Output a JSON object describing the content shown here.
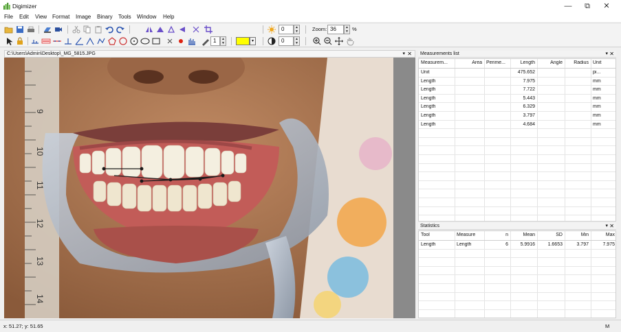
{
  "window": {
    "title": "Digimizer",
    "controls": {
      "minimize": "—",
      "maximize": "⧉",
      "close": "✕"
    }
  },
  "menu": [
    "File",
    "Edit",
    "View",
    "Format",
    "Image",
    "Binary",
    "Tools",
    "Window",
    "Help"
  ],
  "toolbar": {
    "brightness_value": "0",
    "contrast_value": "0",
    "zoom_label": "Zoom:",
    "zoom_value": "36",
    "zoom_unit": "%",
    "line_width_value": "1",
    "fill_color": "#ffff00"
  },
  "image_panel": {
    "path": "C:\\Users\\Admin\\Desktop\\_MG_5815.JPG",
    "ruler_labels": [
      "9",
      "10",
      "11",
      "12",
      "13",
      "14"
    ]
  },
  "measurements": {
    "title": "Measurements list",
    "columns": [
      "Measurem...",
      "Area",
      "Perime...",
      "Length",
      "Angle",
      "Radius",
      "Unit"
    ],
    "rows": [
      [
        "Unit",
        "",
        "",
        "475.652",
        "",
        "",
        "pi..."
      ],
      [
        "Length",
        "",
        "",
        "7.975",
        "",
        "",
        "mm"
      ],
      [
        "Length",
        "",
        "",
        "7.722",
        "",
        "",
        "mm"
      ],
      [
        "Length",
        "",
        "",
        "5.443",
        "",
        "",
        "mm"
      ],
      [
        "Length",
        "",
        "",
        "6.329",
        "",
        "",
        "mm"
      ],
      [
        "Length",
        "",
        "",
        "3.797",
        "",
        "",
        "mm"
      ],
      [
        "Length",
        "",
        "",
        "4.684",
        "",
        "",
        "mm"
      ]
    ]
  },
  "statistics": {
    "title": "Statistics",
    "columns": [
      "Tool",
      "Measure",
      "n",
      "Mean",
      "SD",
      "Min",
      "Max"
    ],
    "rows": [
      [
        "Length",
        "Length",
        "6",
        "5.9916",
        "1.6653",
        "3.797",
        "7.975"
      ]
    ]
  },
  "status": {
    "coords": "x: 51.27; y: 51.65",
    "mode": "M"
  }
}
